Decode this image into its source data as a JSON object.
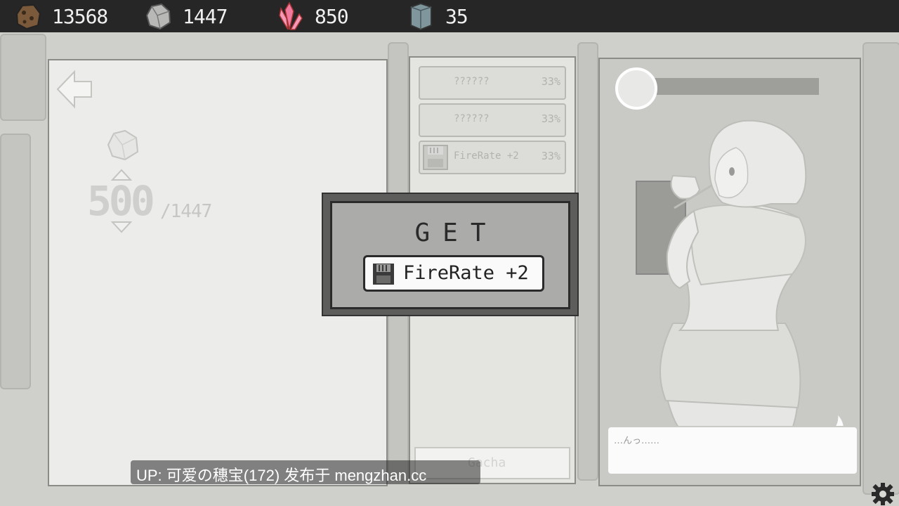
{
  "resources": [
    {
      "icon": "brown-ore-icon",
      "value": "13568"
    },
    {
      "icon": "gray-ore-icon",
      "value": "1447"
    },
    {
      "icon": "pink-crystal-icon",
      "value": "850"
    },
    {
      "icon": "blue-block-icon",
      "value": "35"
    }
  ],
  "exchange": {
    "amount": "500",
    "max": "/1447"
  },
  "gacha_list": [
    {
      "name": "??????",
      "chance": "33%"
    },
    {
      "name": "??????",
      "chance": "33%"
    },
    {
      "name": "FireRate +2",
      "chance": "33%"
    }
  ],
  "gacha_button": "Gacha",
  "modal": {
    "title": "GET",
    "reward": "FireRate +2"
  },
  "dialogue": "…んっ……",
  "watermark": "UP: 可爱の穗宝(172) 发布于 mengzhan.cc",
  "colors": {
    "topbar": "#262626",
    "crystal": "#f07aa0",
    "block": "#7e969c"
  }
}
